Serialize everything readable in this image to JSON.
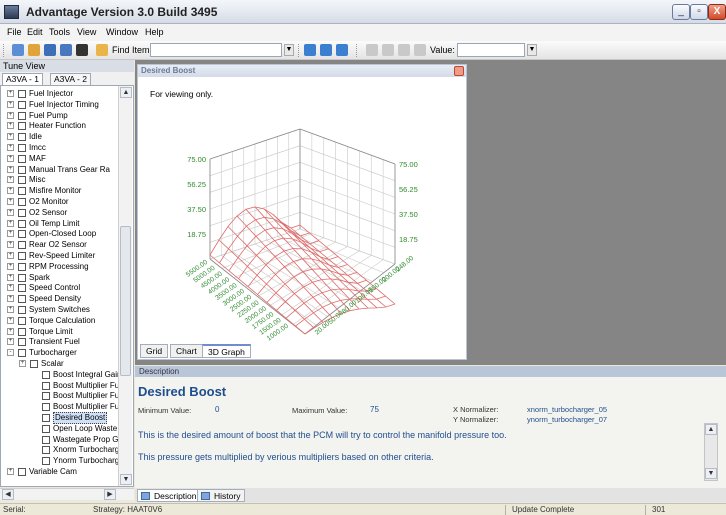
{
  "window": {
    "title": "Advantage Version 3.0 Build 3495",
    "controls": [
      "_",
      "▫",
      "X"
    ]
  },
  "menu": [
    "File",
    "Edit",
    "Tools",
    "View",
    "Window",
    "Help"
  ],
  "toolbar": {
    "find_label": "Find Item:",
    "value_label": "Value:",
    "find_value": "",
    "value_value": ""
  },
  "tune_view": {
    "header": "Tune View",
    "tabs": [
      "A3VA - 1",
      "A3VA - 2"
    ],
    "tree": [
      {
        "label": "Fuel Injector",
        "level": 0,
        "exp": "+"
      },
      {
        "label": "Fuel Injector Timing",
        "level": 0,
        "exp": "+"
      },
      {
        "label": "Fuel Pump",
        "level": 0,
        "exp": "+"
      },
      {
        "label": "Heater Function",
        "level": 0,
        "exp": "+"
      },
      {
        "label": "Idle",
        "level": 0,
        "exp": "+"
      },
      {
        "label": "Imcc",
        "level": 0,
        "exp": "+"
      },
      {
        "label": "MAF",
        "level": 0,
        "exp": "+"
      },
      {
        "label": "Manual Trans Gear Ra",
        "level": 0,
        "exp": "+"
      },
      {
        "label": "Misc",
        "level": 0,
        "exp": "+"
      },
      {
        "label": "Misfire Monitor",
        "level": 0,
        "exp": "+"
      },
      {
        "label": "O2 Monitor",
        "level": 0,
        "exp": "+"
      },
      {
        "label": "O2 Sensor",
        "level": 0,
        "exp": "+"
      },
      {
        "label": "Oil Temp Limit",
        "level": 0,
        "exp": "+"
      },
      {
        "label": "Open-Closed Loop",
        "level": 0,
        "exp": "+"
      },
      {
        "label": "Rear O2 Sensor",
        "level": 0,
        "exp": "+"
      },
      {
        "label": "Rev-Speed Limiter",
        "level": 0,
        "exp": "+"
      },
      {
        "label": "RPM Processing",
        "level": 0,
        "exp": "+"
      },
      {
        "label": "Spark",
        "level": 0,
        "exp": "+"
      },
      {
        "label": "Speed Control",
        "level": 0,
        "exp": "+"
      },
      {
        "label": "Speed Density",
        "level": 0,
        "exp": "+"
      },
      {
        "label": "System Switches",
        "level": 0,
        "exp": "+"
      },
      {
        "label": "Torque Calculation",
        "level": 0,
        "exp": "+"
      },
      {
        "label": "Torque Limit",
        "level": 0,
        "exp": "+"
      },
      {
        "label": "Transient Fuel",
        "level": 0,
        "exp": "+"
      },
      {
        "label": "Turbocharger",
        "level": 0,
        "exp": "-"
      },
      {
        "label": "Scalar",
        "level": 1,
        "exp": "+"
      },
      {
        "label": "Boost Integral Gair",
        "level": 2,
        "exp": ""
      },
      {
        "label": "Boost Multiplier Fu",
        "level": 2,
        "exp": ""
      },
      {
        "label": "Boost Multiplier Fu",
        "level": 2,
        "exp": ""
      },
      {
        "label": "Boost Multiplier Fu",
        "level": 2,
        "exp": ""
      },
      {
        "label": "Desired Boost",
        "level": 2,
        "exp": "",
        "selected": true
      },
      {
        "label": "Open Loop Waste",
        "level": 2,
        "exp": ""
      },
      {
        "label": "Wastegate Prop G",
        "level": 2,
        "exp": ""
      },
      {
        "label": "Xnorm Turbocharg",
        "level": 2,
        "exp": ""
      },
      {
        "label": "Ynorm Turbocharg",
        "level": 2,
        "exp": ""
      },
      {
        "label": "Variable Cam",
        "level": 0,
        "exp": "+"
      }
    ]
  },
  "graph_window": {
    "title": "Desired Boost",
    "note": "For viewing only.",
    "z_ticks": [
      "75.00",
      "56.25",
      "37.50",
      "18.75"
    ],
    "left_axis_ticks": [
      "5500.00",
      "5000.00",
      "4500.00",
      "4000.00",
      "3500.00",
      "3000.00",
      "2500.00",
      "2250.00",
      "2000.00",
      "1750.00",
      "1500.00",
      "1000.00"
    ],
    "right_axis_ticks": [
      "248.00",
      "200.00",
      "150.00",
      "100.00",
      "80.00",
      "50.00",
      "20.00"
    ],
    "tabs": [
      "Grid",
      "Chart",
      "3D Graph"
    ],
    "active_tab": "3D Graph"
  },
  "description": {
    "header": "Description",
    "title": "Desired Boost",
    "min_label": "Minimum Value:",
    "min_value": "0",
    "max_label": "Maximum Value:",
    "max_value": "75",
    "xnorm_label": "X Normalizer:",
    "xnorm_value": "xnorm_turbocharger_05",
    "ynorm_label": "Y Normalizer:",
    "ynorm_value": "ynorm_turbocharger_07",
    "text1": "This is the desired amount of boost that the PCM will try to control the manifold pressure too.",
    "text2": "This pressure gets multiplied by verious multipliers based on other criteria."
  },
  "bottom_tabs": [
    "Description",
    "History"
  ],
  "status": {
    "serial": "Serial:",
    "strategy": "Strategy: HAAT0V6",
    "update": "Update Complete",
    "count": "301"
  },
  "colors": {
    "mesh": "#e06b6b",
    "axis_label": "#2e8b2e",
    "desc_text": "#1f4e8c"
  }
}
